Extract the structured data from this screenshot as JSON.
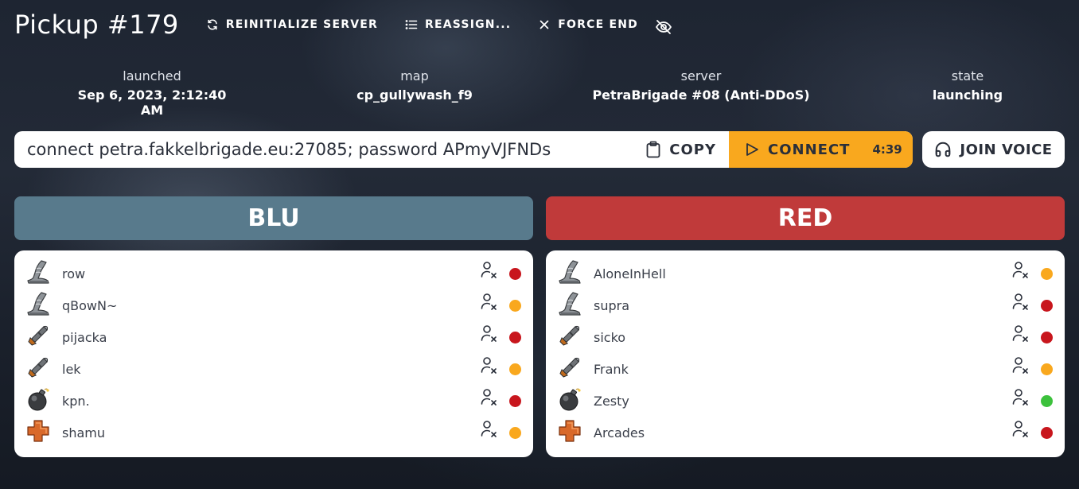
{
  "header": {
    "title": "Pickup #179",
    "reinit_label": "REINITIALIZE SERVER",
    "reassign_label": "REASSIGN...",
    "force_end_label": "FORCE END"
  },
  "info": {
    "launched": {
      "label": "launched",
      "value": "Sep 6, 2023, 2:12:40 AM"
    },
    "map": {
      "label": "map",
      "value": "cp_gullywash_f9"
    },
    "server": {
      "label": "server",
      "value": "PetraBrigade #08 (Anti-DDoS)"
    },
    "state": {
      "label": "state",
      "value": "launching"
    }
  },
  "connect": {
    "command": "connect petra.fakkelbrigade.eu:27085; password APmyVJFNDs",
    "copy_label": "COPY",
    "connect_label": "CONNECT",
    "timer": "4:39",
    "voice_label": "JOIN VOICE"
  },
  "teams": {
    "blu": {
      "name": "BLU",
      "color": "#587a8c",
      "players": [
        {
          "name": "row",
          "class": "scout",
          "status": "red"
        },
        {
          "name": "qBowN~",
          "class": "scout",
          "status": "orange"
        },
        {
          "name": "pijacka",
          "class": "soldier",
          "status": "red"
        },
        {
          "name": "lek",
          "class": "soldier",
          "status": "orange"
        },
        {
          "name": "kpn.",
          "class": "demoman",
          "status": "red"
        },
        {
          "name": "shamu",
          "class": "medic",
          "status": "orange"
        }
      ]
    },
    "red": {
      "name": "RED",
      "color": "#c03a3a",
      "players": [
        {
          "name": "AloneInHell",
          "class": "scout",
          "status": "orange"
        },
        {
          "name": "supra",
          "class": "scout",
          "status": "red"
        },
        {
          "name": "sicko",
          "class": "soldier",
          "status": "red"
        },
        {
          "name": "Frank",
          "class": "soldier",
          "status": "orange"
        },
        {
          "name": "Zesty",
          "class": "demoman",
          "status": "green"
        },
        {
          "name": "Arcades",
          "class": "medic",
          "status": "red"
        }
      ]
    }
  },
  "status_colors": {
    "red": "#c8161d",
    "orange": "#f9a81e",
    "green": "#3cc13c"
  }
}
